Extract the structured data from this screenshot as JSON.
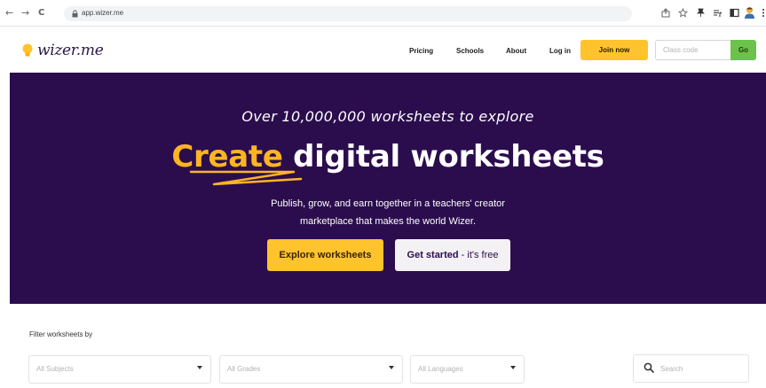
{
  "browser": {
    "back_icon": "←",
    "forward_icon": "→",
    "reload_icon": "C",
    "lock_icon": "lock-icon",
    "url": "app.wizer.me"
  },
  "header": {
    "logo_text": "wizer.me",
    "nav": {
      "pricing": "Pricing",
      "schools": "Schools",
      "about": "About",
      "login": "Log in"
    },
    "join_label": "Join now",
    "class_code_placeholder": "Class code",
    "go_label": "Go"
  },
  "hero": {
    "tagline": "Over 10,000,000 worksheets to explore",
    "title_accent": "Create",
    "title_rest": " digital worksheets",
    "desc_line1": "Publish, grow, and earn together in a teachers' creator",
    "desc_line2": "marketplace that makes the world Wizer.",
    "explore_label": "Explore worksheets",
    "get_started_bold": "Get started",
    "get_started_rest": " - it's free"
  },
  "filters": {
    "label": "Filter worksheets by",
    "subjects_placeholder": "All Subjects",
    "grades_placeholder": "All Grades",
    "languages_placeholder": "All Languages",
    "search_placeholder": "Search"
  },
  "colors": {
    "brand_purple": "#2b0d4e",
    "accent_yellow": "#ffc32e",
    "go_green": "#6cc24a"
  }
}
